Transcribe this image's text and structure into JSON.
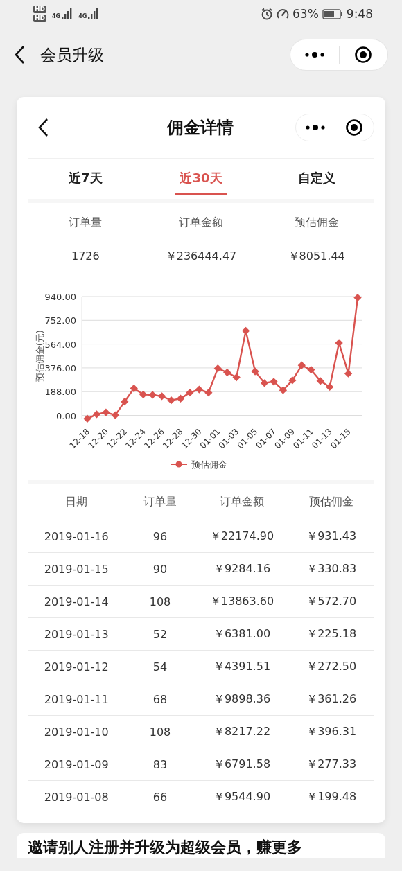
{
  "status_bar": {
    "sim_labels": [
      "HD",
      "HD"
    ],
    "network_labels": [
      "4G",
      "4G"
    ],
    "battery": "63%",
    "time": "9:48"
  },
  "nav": {
    "title": "会员升级"
  },
  "card": {
    "title": "佣金详情",
    "tabs": [
      {
        "label": "近7天",
        "selected": false
      },
      {
        "label": "近30天",
        "selected": true
      },
      {
        "label": "自定义",
        "selected": false
      }
    ],
    "summary": [
      {
        "label": "订单量",
        "value": "1726"
      },
      {
        "label": "订单金额",
        "value": "￥236444.47"
      },
      {
        "label": "预估佣金",
        "value": "￥8051.44"
      }
    ],
    "chart_data": {
      "type": "line",
      "ylabel": "预估佣金(元)",
      "grid": true,
      "ylim": [
        -30,
        940
      ],
      "categories": [
        "12-18",
        null,
        "12-20",
        null,
        "12-22",
        null,
        "12-24",
        null,
        "12-26",
        null,
        "12-28",
        null,
        "12-30",
        null,
        "01-01",
        null,
        "01-03",
        null,
        "01-05",
        null,
        "01-07",
        null,
        "01-09",
        null,
        "01-11",
        null,
        "01-13",
        null,
        "01-15",
        null
      ],
      "series": [
        {
          "name": "预估佣金",
          "color": "#d9534f",
          "marker": "diamond",
          "values": [
            -26,
            9,
            24,
            2,
            109,
            214,
            165,
            162,
            152,
            120,
            133,
            180,
            205,
            180,
            372,
            340,
            301,
            669,
            348,
            256,
            267,
            199.48,
            277.33,
            396.31,
            361.26,
            272.5,
            225.18,
            572.7,
            330.83,
            931.43
          ]
        }
      ],
      "yticks": [
        {
          "value": 0,
          "label": "0.00"
        },
        {
          "value": 188,
          "label": "188.00"
        },
        {
          "value": 376,
          "label": "376.00"
        },
        {
          "value": 564,
          "label": "564.00"
        },
        {
          "value": 752,
          "label": "752.00"
        },
        {
          "value": 940,
          "label": "940.00"
        }
      ]
    },
    "table": {
      "columns": [
        "日期",
        "订单量",
        "订单金额",
        "预估佣金"
      ],
      "rows": [
        [
          "2019-01-16",
          "96",
          "￥22174.90",
          "￥931.43"
        ],
        [
          "2019-01-15",
          "90",
          "￥9284.16",
          "￥330.83"
        ],
        [
          "2019-01-14",
          "108",
          "￥13863.60",
          "￥572.70"
        ],
        [
          "2019-01-13",
          "52",
          "￥6381.00",
          "￥225.18"
        ],
        [
          "2019-01-12",
          "54",
          "￥4391.51",
          "￥272.50"
        ],
        [
          "2019-01-11",
          "68",
          "￥9898.36",
          "￥361.26"
        ],
        [
          "2019-01-10",
          "108",
          "￥8217.22",
          "￥396.31"
        ],
        [
          "2019-01-09",
          "83",
          "￥6791.58",
          "￥277.33"
        ],
        [
          "2019-01-08",
          "66",
          "￥9544.90",
          "￥199.48"
        ]
      ]
    }
  },
  "promo": {
    "title": "邀请别人注册并升级为超级会员，赚更多"
  }
}
